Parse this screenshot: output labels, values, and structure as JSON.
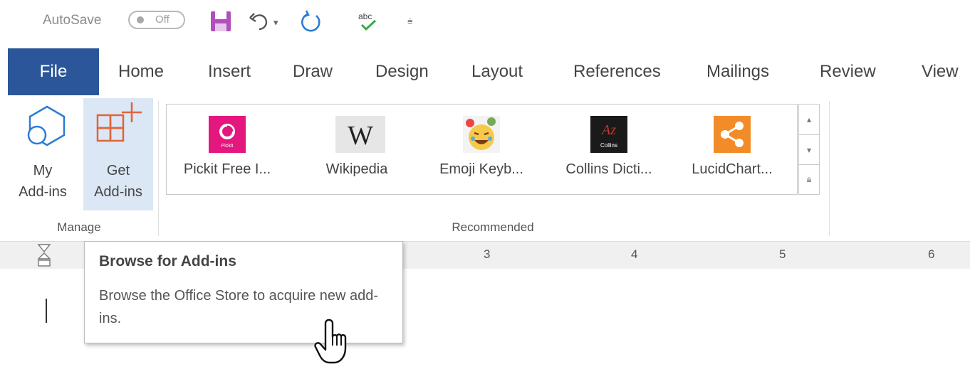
{
  "qat": {
    "autosave_label": "AutoSave",
    "toggle_state": "Off",
    "icons": [
      "save-icon",
      "undo-icon",
      "redo-icon",
      "spelling-icon",
      "customize-icon"
    ]
  },
  "tabs": [
    "File",
    "Home",
    "Insert",
    "Draw",
    "Design",
    "Layout",
    "References",
    "Mailings",
    "Review",
    "View"
  ],
  "ribbon": {
    "manage": {
      "my_addins_line1": "My",
      "my_addins_line2": "Add-ins",
      "get_addins_line1": "Get",
      "get_addins_line2": "Add-ins",
      "group_label": "Manage"
    },
    "recommended": {
      "group_label": "Recommended",
      "items": [
        {
          "label": "Pickit Free I...",
          "icon": "pickit-icon",
          "color": "#e4177f"
        },
        {
          "label": "Wikipedia",
          "icon": "wikipedia-icon",
          "color": "#e6e6e6"
        },
        {
          "label": "Emoji Keyb...",
          "icon": "emoji-icon",
          "color": "#f7c948"
        },
        {
          "label": "Collins Dicti...",
          "icon": "collins-icon",
          "color": "#1a1a1a"
        },
        {
          "label": "LucidChart...",
          "icon": "lucidchart-icon",
          "color": "#f28c28"
        }
      ]
    }
  },
  "ruler": {
    "numbers": [
      "3",
      "4",
      "5",
      "6"
    ]
  },
  "tooltip": {
    "title": "Browse for Add-ins",
    "desc": "Browse the Office Store to acquire new add-ins."
  },
  "colors": {
    "accent": "#2b579a",
    "highlight": "#dbe7f5",
    "get_addins_orange": "#e0653a"
  }
}
